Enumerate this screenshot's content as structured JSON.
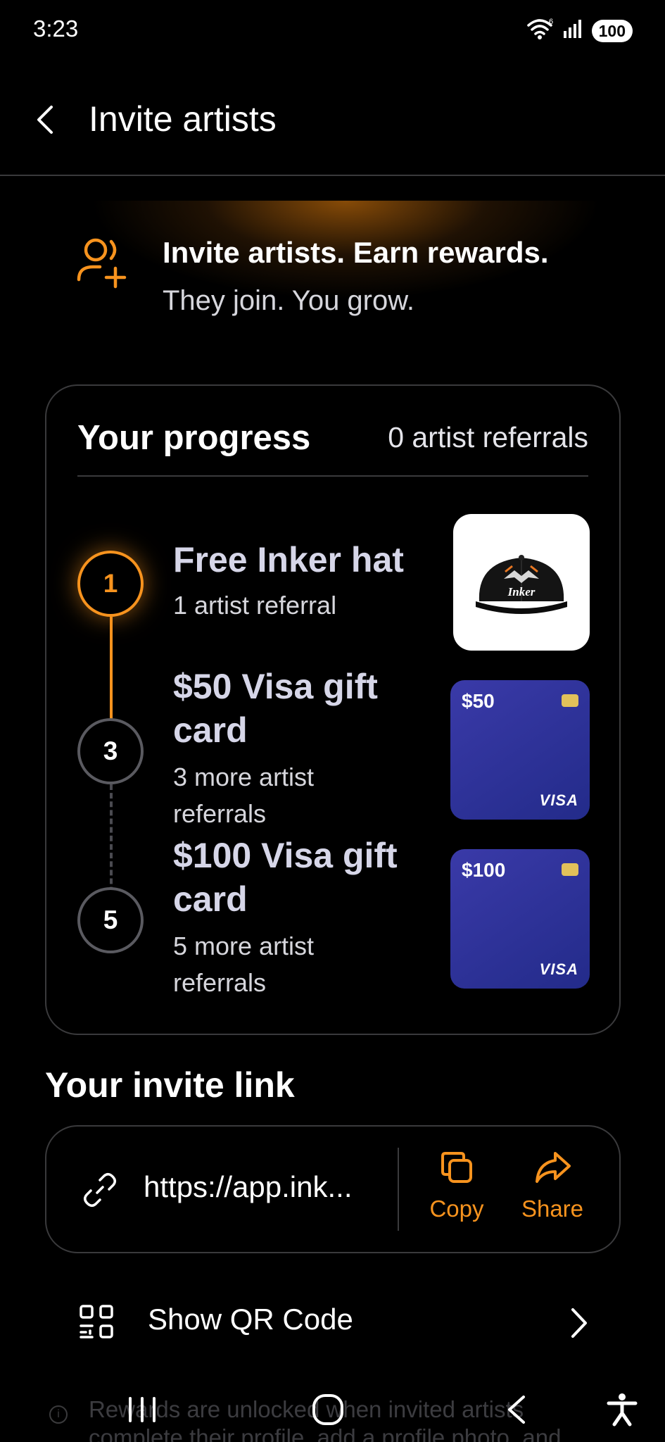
{
  "status_bar": {
    "time": "3:23",
    "battery": "100",
    "network_label": "6"
  },
  "header": {
    "title": "Invite artists"
  },
  "hero": {
    "title": "Invite artists. Earn rewards.",
    "subtitle": "They join. You grow."
  },
  "progress": {
    "title": "Your progress",
    "count_text": "0 artist referrals",
    "steps": [
      {
        "number": "1",
        "title": "Free Inker hat",
        "subtitle": "1 artist referral",
        "status": "active"
      },
      {
        "number": "3",
        "title": "$50 Visa gift card",
        "subtitle": "3 more artist referrals",
        "card_amount": "$50",
        "card_brand": "VISA"
      },
      {
        "number": "5",
        "title": "$100 Visa gift card",
        "subtitle": "5 more artist referrals",
        "card_amount": "$100",
        "card_brand": "VISA"
      }
    ],
    "hat_brand": "Inker"
  },
  "invite_link": {
    "section_title": "Your invite link",
    "url": "https://app.ink...",
    "copy_label": "Copy",
    "share_label": "Share"
  },
  "qr": {
    "label": "Show QR Code"
  },
  "footnote": {
    "text": "Rewards are unlocked when invited artists complete their profile, add a profile photo, and"
  },
  "colors": {
    "accent": "#f7931e",
    "background": "#000000",
    "card_border": "#3a3a3c",
    "gift_card": "#2b2f96"
  }
}
